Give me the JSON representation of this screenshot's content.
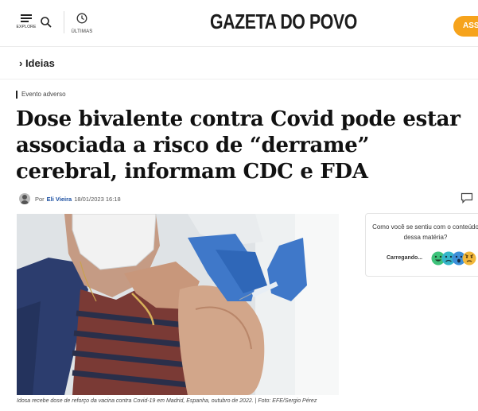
{
  "header": {
    "explore_label": "EXPLORE",
    "ultimas_label": "ÚLTIMAS",
    "brand": "GAZETA DO POVO",
    "subscribe_label": "ASS",
    "accent_color": "#f6a31c"
  },
  "breadcrumb": {
    "section": "› Ideias"
  },
  "article": {
    "tag": "Evento adverso",
    "headline": "Dose bivalente contra Covid pode estar associada a risco de “derrame” cerebral, informam CDC e FDA",
    "by_prefix": "Por",
    "author": "Eli Vieira",
    "datetime": "18/01/2023 16:18",
    "photo_caption": "Idosa recebe dose de reforço da vacina contra Covid-19 em Madrid, Espanha, outubro de 2022. | Foto: EFE/Sergio Pérez"
  },
  "feedback_widget": {
    "question": "Como você se sentiu com o conteúdo dessa matéria?",
    "loading_label": "Carregando...",
    "icons": [
      "happy-face-icon",
      "sad-face-icon",
      "surprised-face-icon",
      "angry-face-icon"
    ]
  }
}
